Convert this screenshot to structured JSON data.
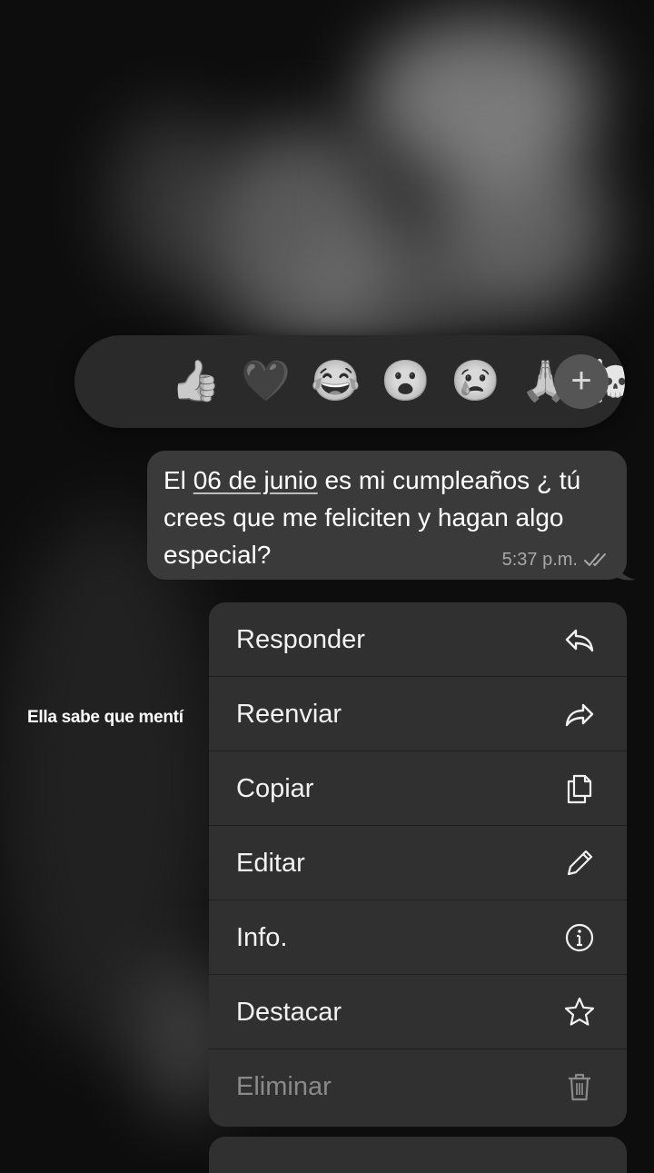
{
  "reactions": {
    "emojis": [
      "👍",
      "🖤",
      "😂",
      "😮",
      "😢",
      "🙏",
      "☠️"
    ],
    "icons": [
      "thumbs-up-emoji",
      "heart-emoji",
      "laughing-emoji",
      "surprised-emoji",
      "crying-emoji",
      "praying-hands-emoji",
      "skull-emoji"
    ],
    "more_label": "+"
  },
  "message": {
    "text_before": "El ",
    "date_link": "06 de junio",
    "text_after": " es mi cumpleaños ¿ tú crees que me feliciten y hagan algo especial?",
    "time": "5:37 p.m.",
    "status_icon": "double-check-icon"
  },
  "caption": "Ella sabe que mentí",
  "menu": {
    "items": [
      {
        "label": "Responder",
        "icon": "reply-icon"
      },
      {
        "label": "Reenviar",
        "icon": "forward-icon"
      },
      {
        "label": "Copiar",
        "icon": "copy-icon"
      },
      {
        "label": "Editar",
        "icon": "pencil-icon"
      },
      {
        "label": "Info.",
        "icon": "info-icon"
      },
      {
        "label": "Destacar",
        "icon": "star-icon"
      },
      {
        "label": "Eliminar",
        "icon": "trash-icon",
        "disabled": true
      }
    ]
  },
  "colors": {
    "background": "#0d0d0d",
    "bubble": "#3a3a3a",
    "menu": "#303030",
    "reaction_bar": "#2a2a2a"
  }
}
